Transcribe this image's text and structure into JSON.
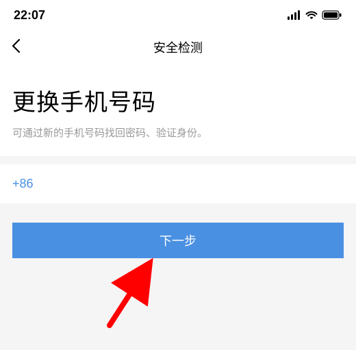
{
  "status_bar": {
    "time": "22:07"
  },
  "nav": {
    "title": "安全检测"
  },
  "header": {
    "title": "更换手机号码",
    "subtitle": "可通过新的手机号码找回密码、验证身份。"
  },
  "phone": {
    "country_code": "+86",
    "value": ""
  },
  "actions": {
    "next_label": "下一步"
  },
  "colors": {
    "accent": "#4a90e2",
    "annotation": "#ff0000"
  }
}
